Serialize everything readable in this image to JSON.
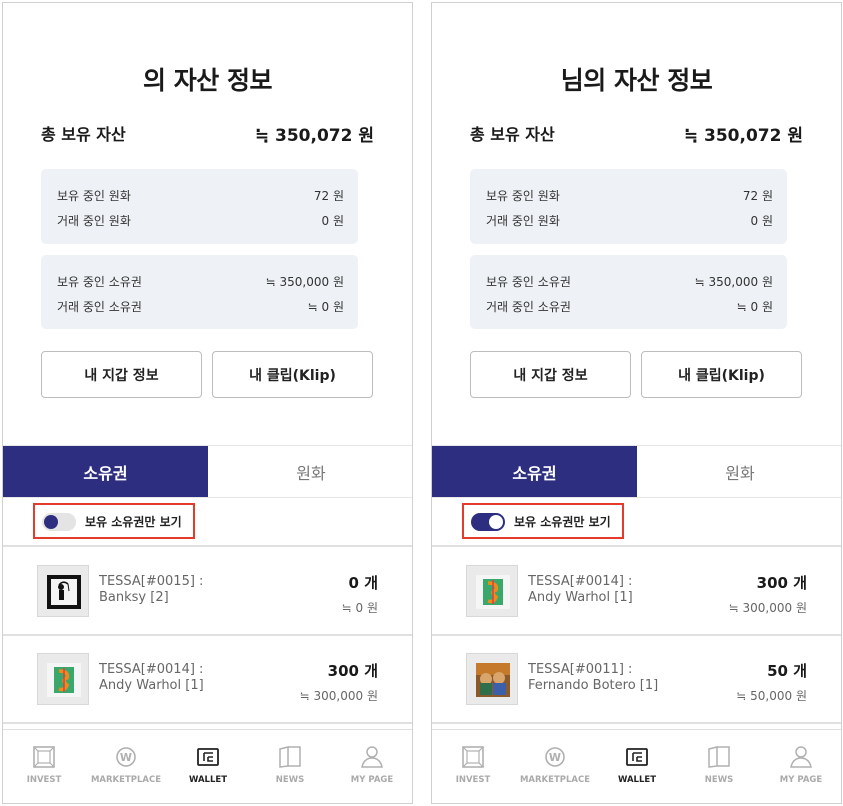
{
  "screens": [
    {
      "title": "의 자산 정보",
      "total_label": "총 보유 자산",
      "total_value": "≒ 350,072 원",
      "cash": [
        {
          "label": "보유 중인 원화",
          "value": "72 원"
        },
        {
          "label": "거래 중인 원화",
          "value": "0 원"
        }
      ],
      "tokens": [
        {
          "label": "보유 중인 소유권",
          "value": "≒ 350,000 원"
        },
        {
          "label": "거래 중인 소유권",
          "value": "≒ 0 원"
        }
      ],
      "buttons": {
        "wallet_info": "내 지갑 정보",
        "klip": "내 클립(Klip)"
      },
      "tabs": {
        "active": "소유권",
        "inactive": "원화"
      },
      "toggle": {
        "label": "보유 소유권만 보기",
        "state": "off"
      },
      "items": [
        {
          "name_line1": "TESSA[#0015] :",
          "name_line2": "Banksy [2]",
          "qty": "0 개",
          "krw": "≒ 0 원",
          "thumb": "banksy"
        },
        {
          "name_line1": "TESSA[#0014] :",
          "name_line2": "Andy Warhol [1]",
          "qty": "300 개",
          "krw": "≒ 300,000 원",
          "thumb": "warhol"
        }
      ]
    },
    {
      "title": "님의 자산 정보",
      "total_label": "총 보유 자산",
      "total_value": "≒ 350,072 원",
      "cash": [
        {
          "label": "보유 중인 원화",
          "value": "72 원"
        },
        {
          "label": "거래 중인 원화",
          "value": "0 원"
        }
      ],
      "tokens": [
        {
          "label": "보유 중인 소유권",
          "value": "≒ 350,000 원"
        },
        {
          "label": "거래 중인 소유권",
          "value": "≒ 0 원"
        }
      ],
      "buttons": {
        "wallet_info": "내 지갑 정보",
        "klip": "내 클립(Klip)"
      },
      "tabs": {
        "active": "소유권",
        "inactive": "원화"
      },
      "toggle": {
        "label": "보유 소유권만 보기",
        "state": "on"
      },
      "items": [
        {
          "name_line1": "TESSA[#0014] :",
          "name_line2": "Andy Warhol [1]",
          "qty": "300 개",
          "krw": "≒ 300,000 원",
          "thumb": "warhol"
        },
        {
          "name_line1": "TESSA[#0011] :",
          "name_line2": "Fernando Botero [1]",
          "qty": "50 개",
          "krw": "≒ 50,000 원",
          "thumb": "botero"
        }
      ]
    }
  ],
  "nav": [
    {
      "label": "INVEST",
      "icon": "invest-icon"
    },
    {
      "label": "MARKETPLACE",
      "icon": "marketplace-icon"
    },
    {
      "label": "WALLET",
      "icon": "wallet-icon",
      "active": true
    },
    {
      "label": "NEWS",
      "icon": "news-icon"
    },
    {
      "label": "MY PAGE",
      "icon": "mypage-icon"
    }
  ],
  "colors": {
    "accent": "#2d2e7f",
    "highlight": "#e53b2c",
    "panel": "#eef2f6"
  }
}
